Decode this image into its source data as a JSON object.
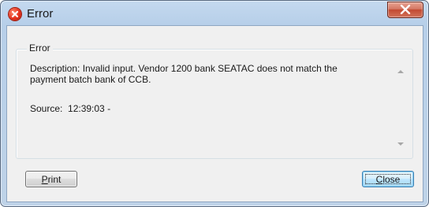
{
  "window": {
    "title": "Error"
  },
  "group": {
    "label": "Error"
  },
  "message": {
    "description_line1": "Description: Invalid input. Vendor 1200 bank SEATAC does not match the",
    "description_line2": "payment batch bank of CCB.",
    "source": "Source:  12:39:03 -"
  },
  "buttons": {
    "print_mnemonic": "P",
    "print_rest": "rint",
    "close_mnemonic": "C",
    "close_rest": "lose"
  },
  "icons": {
    "title_icon": "error-icon",
    "close_window": "close-icon"
  },
  "colors": {
    "error_red": "#e3301b",
    "close_button": "#c24a31"
  }
}
